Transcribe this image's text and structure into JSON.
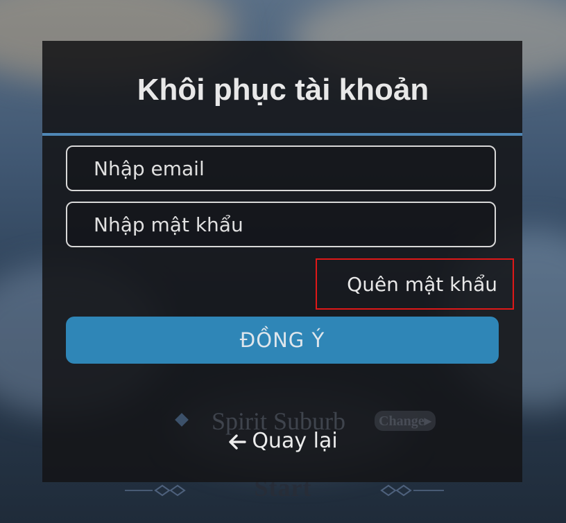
{
  "dialog": {
    "title": "Khôi phục tài khoản",
    "accent_color": "#4f87b5"
  },
  "form": {
    "email_placeholder": "Nhập email",
    "password_placeholder": "Nhập mật khẩu",
    "forgot_password_label": "Quên mật khẩu",
    "submit_label": "ĐỒNG Ý",
    "submit_color": "#2f86b7"
  },
  "navigation": {
    "back_label": "Quay lại",
    "back_icon": "arrow-left-icon"
  },
  "background_game": {
    "location_name": "Spirit Suburb",
    "change_label": "Change",
    "start_label": "Start"
  },
  "highlight": {
    "color": "#e01818",
    "target": "forgot-password-link"
  }
}
